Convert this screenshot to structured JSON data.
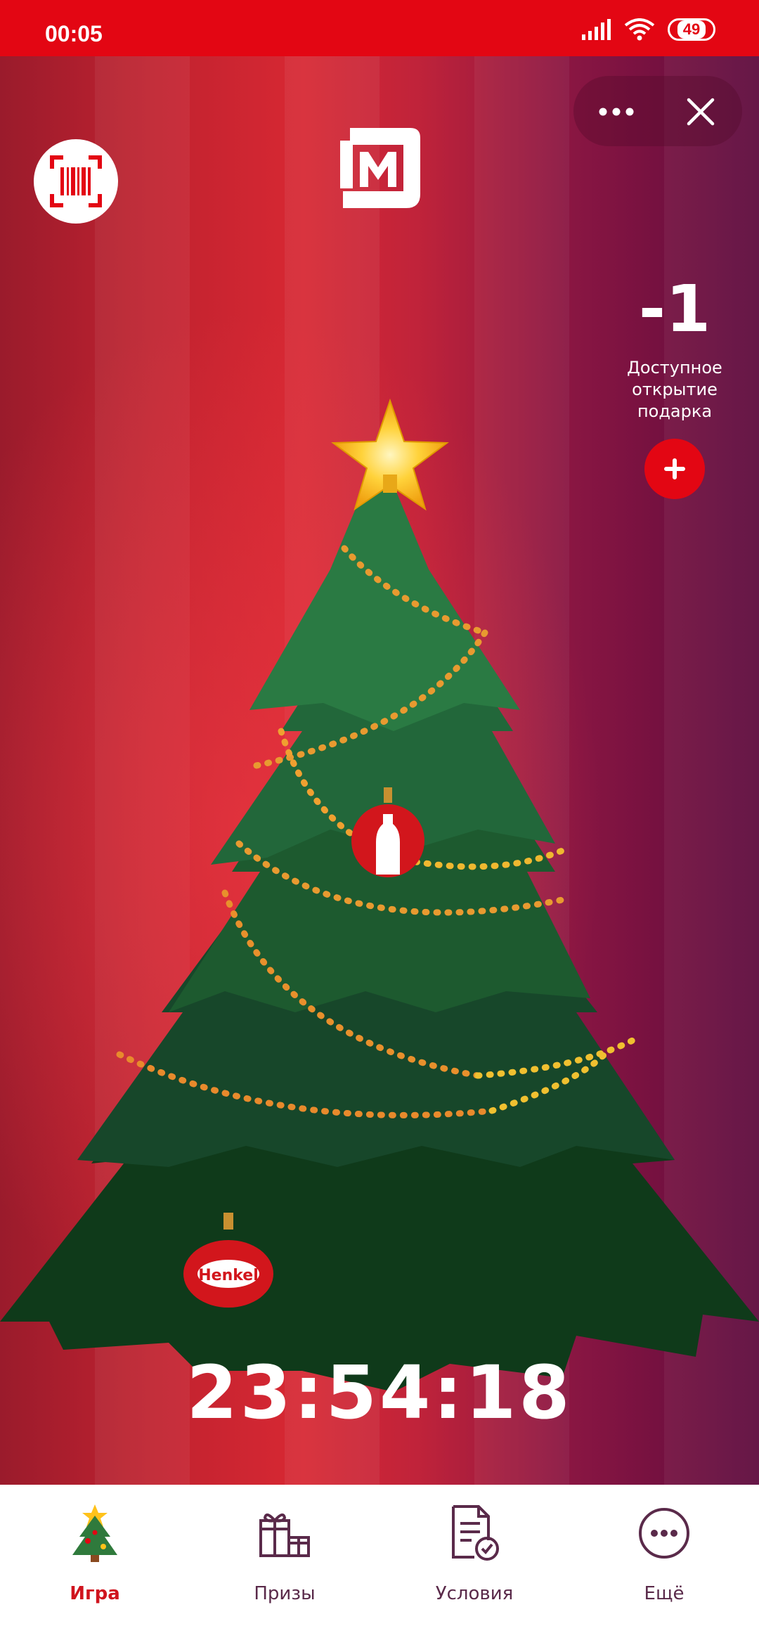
{
  "status_bar": {
    "time": "00:05",
    "battery": "49"
  },
  "header": {
    "more_icon": "more-dots-icon",
    "close_icon": "close-icon",
    "scan_icon": "barcode-scan-icon",
    "logo_icon": "magnit-logo-icon"
  },
  "gifts": {
    "count": "-1",
    "label_line1": "Доступное",
    "label_line2": "открытие",
    "label_line3": "подарка"
  },
  "ornaments": {
    "brand_ball": "Henkel"
  },
  "timer": "23:54:18",
  "nav": [
    {
      "label": "Игра",
      "icon": "christmas-tree-icon",
      "active": true
    },
    {
      "label": "Призы",
      "icon": "gifts-icon",
      "active": false
    },
    {
      "label": "Условия",
      "icon": "document-check-icon",
      "active": false
    },
    {
      "label": "Ещё",
      "icon": "more-circle-icon",
      "active": false
    }
  ],
  "colors": {
    "brand_red": "#e30613",
    "tree_green": "#1f5a2d",
    "nav_text": "#5a2a4a"
  }
}
